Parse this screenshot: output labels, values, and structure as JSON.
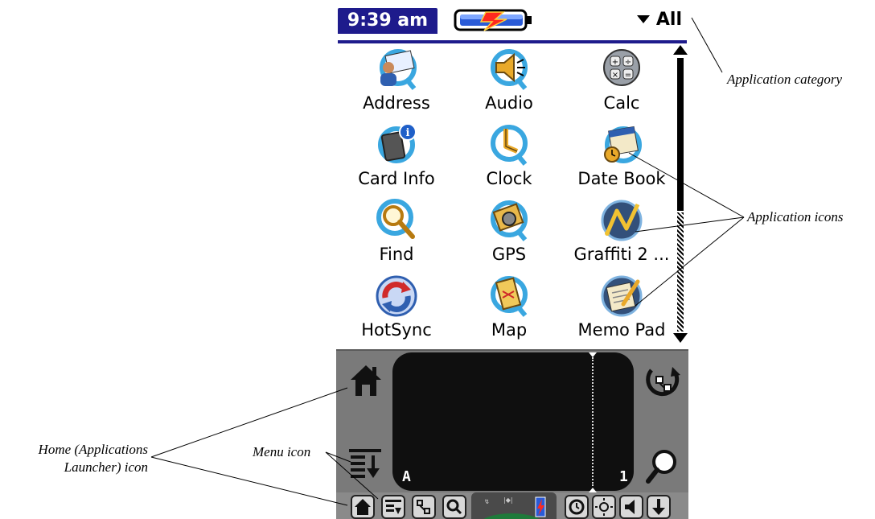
{
  "status_bar": {
    "time": "9:39 am",
    "category": "All"
  },
  "apps": [
    {
      "label": "Address"
    },
    {
      "label": "Audio"
    },
    {
      "label": "Calc"
    },
    {
      "label": "Card Info"
    },
    {
      "label": "Clock"
    },
    {
      "label": "Date Book"
    },
    {
      "label": "Find"
    },
    {
      "label": "GPS"
    },
    {
      "label": "Graffiti 2 ..."
    },
    {
      "label": "HotSync"
    },
    {
      "label": "Map"
    },
    {
      "label": "Memo Pad"
    }
  ],
  "graffiti": {
    "alpha_marker": "A",
    "numeric_marker": "1"
  },
  "annotations": {
    "application_category": "Application category",
    "application_icons": "Application icons",
    "home_icon_line1": "Home (Applications",
    "home_icon_line2": "Launcher) icon",
    "menu_icon": "Menu icon"
  },
  "colors": {
    "title_bar": "#1e1b8c",
    "icon_ring": "#3aa7e0",
    "graffiti_bg": "#7a7a7a",
    "writing_pad": "#0f0f0f"
  }
}
